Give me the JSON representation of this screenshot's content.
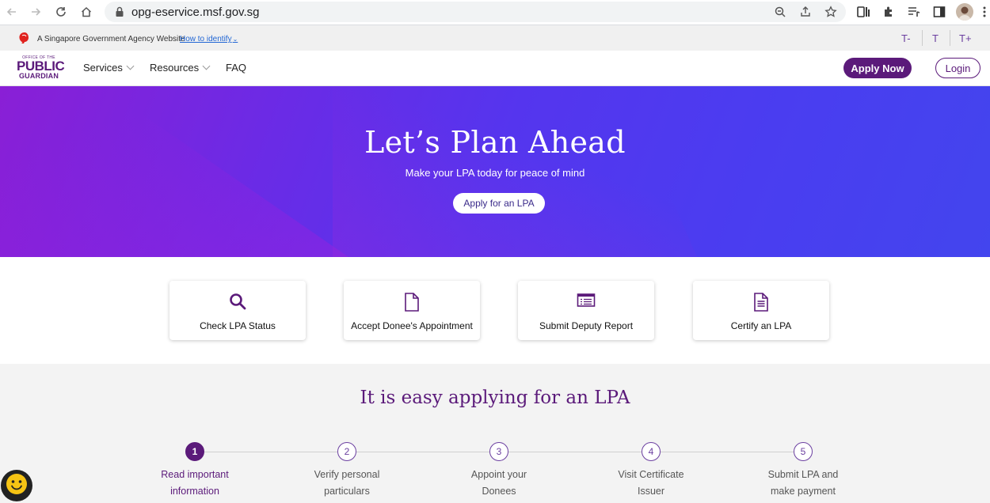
{
  "browser": {
    "url": "opg-eservice.msf.gov.sg"
  },
  "masthead": {
    "gov_text": "A Singapore Government Agency Website",
    "identify_link": "How to identify",
    "font_controls": [
      "T-",
      "T",
      "T+"
    ]
  },
  "header": {
    "logo": {
      "line1": "OFFICE OF THE",
      "line2": "PUBLIC",
      "line3": "GUARDIAN"
    },
    "nav": [
      {
        "label": "Services",
        "has_dropdown": true
      },
      {
        "label": "Resources",
        "has_dropdown": true
      },
      {
        "label": "FAQ",
        "has_dropdown": false
      }
    ],
    "apply_now": "Apply Now",
    "login": "Login"
  },
  "hero": {
    "title": "Let’s Plan Ahead",
    "subtitle": "Make your LPA today for peace of mind",
    "cta": "Apply for an LPA"
  },
  "quick_links": [
    {
      "label": "Check LPA Status",
      "icon": "search-icon"
    },
    {
      "label": "Accept Donee's Appointment",
      "icon": "document-icon"
    },
    {
      "label": "Submit Deputy Report",
      "icon": "report-icon"
    },
    {
      "label": "Certify an LPA",
      "icon": "certificate-icon"
    }
  ],
  "steps": {
    "title": "It is easy applying for an LPA",
    "items": [
      {
        "number": "1",
        "line1": "Read important",
        "line2": "information",
        "active": true
      },
      {
        "number": "2",
        "line1": "Verify personal",
        "line2": "particulars",
        "active": false
      },
      {
        "number": "3",
        "line1": "Appoint your",
        "line2": "Donees",
        "active": false
      },
      {
        "number": "4",
        "line1": "Visit Certificate",
        "line2": "Issuer",
        "active": false
      },
      {
        "number": "5",
        "line1": "Submit LPA and",
        "line2": "make payment",
        "active": false
      }
    ]
  },
  "colors": {
    "brand_purple": "#5b1a7a",
    "hero_start": "#8a1fd6",
    "hero_end": "#4345ee",
    "link_blue": "#2166d4"
  }
}
